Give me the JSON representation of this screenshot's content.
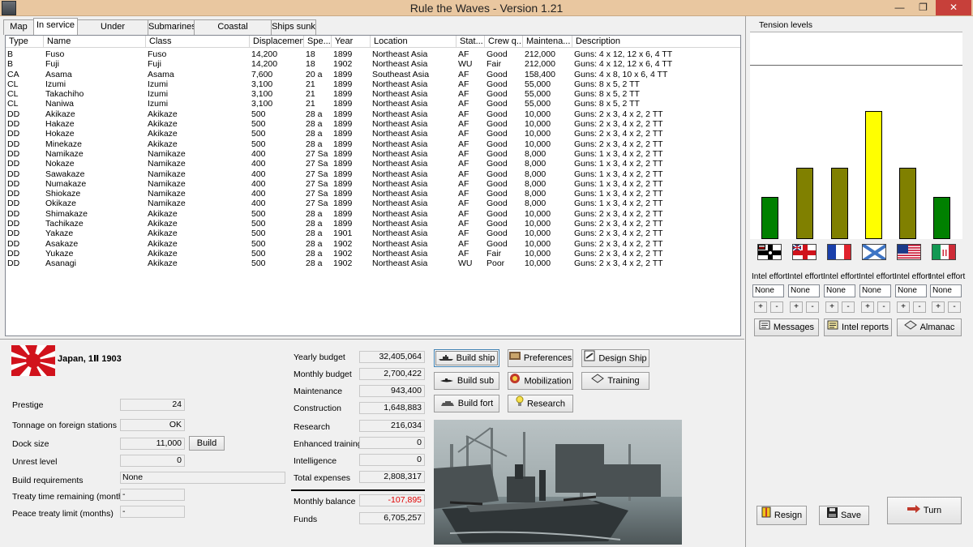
{
  "window": {
    "title": "Rule the Waves - Version 1.21",
    "min_glyph": "—",
    "max_glyph": "❐",
    "close_glyph": "✕"
  },
  "tabs": [
    {
      "label": "Map"
    },
    {
      "label": "In service"
    },
    {
      "label": "Under construction"
    },
    {
      "label": "Submarines"
    },
    {
      "label": "Coastal fortifications"
    },
    {
      "label": "Ships sunk"
    }
  ],
  "table": {
    "columns": [
      "Type",
      "Name",
      "Class",
      "Displacement",
      "Spe...",
      "Year",
      "Location",
      "Stat...",
      "Crew q...",
      "Maintena...",
      "Description"
    ],
    "rows": [
      [
        "B",
        "Fuso",
        "Fuso",
        "14,200",
        "18",
        "1899",
        "Northeast Asia",
        "AF",
        "Good",
        "212,000",
        "Guns: 4 x 12, 12 x 6, 4 TT"
      ],
      [
        "B",
        "Fuji",
        "Fuji",
        "14,200",
        "18",
        "1902",
        "Northeast Asia",
        "WU",
        "Fair",
        "212,000",
        "Guns: 4 x 12, 12 x 6, 4 TT"
      ],
      [
        "CA",
        "Asama",
        "Asama",
        "7,600",
        "20 a",
        "1899",
        "Southeast Asia",
        "AF",
        "Good",
        "158,400",
        "Guns: 4 x 8, 10 x 6, 4 TT"
      ],
      [
        "CL",
        "Izumi",
        "Izumi",
        "3,100",
        "21",
        "1899",
        "Northeast Asia",
        "AF",
        "Good",
        "55,000",
        "Guns: 8 x 5, 2 TT"
      ],
      [
        "CL",
        "Takachiho",
        "Izumi",
        "3,100",
        "21",
        "1899",
        "Northeast Asia",
        "AF",
        "Good",
        "55,000",
        "Guns: 8 x 5, 2 TT"
      ],
      [
        "CL",
        "Naniwa",
        "Izumi",
        "3,100",
        "21",
        "1899",
        "Northeast Asia",
        "AF",
        "Good",
        "55,000",
        "Guns: 8 x 5, 2 TT"
      ],
      [
        "DD",
        "Akikaze",
        "Akikaze",
        "500",
        "28 a",
        "1899",
        "Northeast Asia",
        "AF",
        "Good",
        "10,000",
        "Guns: 2 x 3, 4 x 2, 2 TT"
      ],
      [
        "DD",
        "Hakaze",
        "Akikaze",
        "500",
        "28 a",
        "1899",
        "Northeast Asia",
        "AF",
        "Good",
        "10,000",
        "Guns: 2 x 3, 4 x 2, 2 TT"
      ],
      [
        "DD",
        "Hokaze",
        "Akikaze",
        "500",
        "28 a",
        "1899",
        "Northeast Asia",
        "AF",
        "Good",
        "10,000",
        "Guns: 2 x 3, 4 x 2, 2 TT"
      ],
      [
        "DD",
        "Minekaze",
        "Akikaze",
        "500",
        "28 a",
        "1899",
        "Northeast Asia",
        "AF",
        "Good",
        "10,000",
        "Guns: 2 x 3, 4 x 2, 2 TT"
      ],
      [
        "DD",
        "Namikaze",
        "Namikaze",
        "400",
        "27 Sa",
        "1899",
        "Northeast Asia",
        "AF",
        "Good",
        "8,000",
        "Guns: 1 x 3, 4 x 2, 2 TT"
      ],
      [
        "DD",
        "Nokaze",
        "Namikaze",
        "400",
        "27 Sa",
        "1899",
        "Northeast Asia",
        "AF",
        "Good",
        "8,000",
        "Guns: 1 x 3, 4 x 2, 2 TT"
      ],
      [
        "DD",
        "Sawakaze",
        "Namikaze",
        "400",
        "27 Sa",
        "1899",
        "Northeast Asia",
        "AF",
        "Good",
        "8,000",
        "Guns: 1 x 3, 4 x 2, 2 TT"
      ],
      [
        "DD",
        "Numakaze",
        "Namikaze",
        "400",
        "27 Sa",
        "1899",
        "Northeast Asia",
        "AF",
        "Good",
        "8,000",
        "Guns: 1 x 3, 4 x 2, 2 TT"
      ],
      [
        "DD",
        "Shiokaze",
        "Namikaze",
        "400",
        "27 Sa",
        "1899",
        "Northeast Asia",
        "AF",
        "Good",
        "8,000",
        "Guns: 1 x 3, 4 x 2, 2 TT"
      ],
      [
        "DD",
        "Okikaze",
        "Namikaze",
        "400",
        "27 Sa",
        "1899",
        "Northeast Asia",
        "AF",
        "Good",
        "8,000",
        "Guns: 1 x 3, 4 x 2, 2 TT"
      ],
      [
        "DD",
        "Shimakaze",
        "Akikaze",
        "500",
        "28 a",
        "1899",
        "Northeast Asia",
        "AF",
        "Good",
        "10,000",
        "Guns: 2 x 3, 4 x 2, 2 TT"
      ],
      [
        "DD",
        "Tachikaze",
        "Akikaze",
        "500",
        "28 a",
        "1899",
        "Northeast Asia",
        "AF",
        "Good",
        "10,000",
        "Guns: 2 x 3, 4 x 2, 2 TT"
      ],
      [
        "DD",
        "Yakaze",
        "Akikaze",
        "500",
        "28 a",
        "1901",
        "Northeast Asia",
        "AF",
        "Good",
        "10,000",
        "Guns: 2 x 3, 4 x 2, 2 TT"
      ],
      [
        "DD",
        "Asakaze",
        "Akikaze",
        "500",
        "28 a",
        "1902",
        "Northeast Asia",
        "AF",
        "Good",
        "10,000",
        "Guns: 2 x 3, 4 x 2, 2 TT"
      ],
      [
        "DD",
        "Yukaze",
        "Akikaze",
        "500",
        "28 a",
        "1902",
        "Northeast Asia",
        "AF",
        "Fair",
        "10,000",
        "Guns: 2 x 3, 4 x 2, 2 TT"
      ],
      [
        "DD",
        "Asanagi",
        "Akikaze",
        "500",
        "28 a",
        "1902",
        "Northeast Asia",
        "WU",
        "Poor",
        "10,000",
        "Guns: 2 x 3, 4 x 2, 2 TT"
      ]
    ]
  },
  "nation": {
    "title": "Japan, 1Ⅱ 1903"
  },
  "status": {
    "prestige_label": "Prestige",
    "prestige": "24",
    "tonnage_label": "Tonnage on foreign stations",
    "tonnage": "OK",
    "dock_label": "Dock size",
    "dock": "11,000",
    "dock_build": "Build",
    "unrest_label": "Unrest level",
    "unrest": "0",
    "buildreq_label": "Build requirements",
    "buildreq": "None",
    "treaty_label": "Treaty time remaining (months)",
    "treaty": "-",
    "peace_label": "Peace treaty limit (months)",
    "peace": "-"
  },
  "budget": {
    "yearly_label": "Yearly budget",
    "yearly": "32,405,064",
    "monthly_label": "Monthly budget",
    "monthly": "2,700,422",
    "maint_label": "Maintenance",
    "maint": "943,400",
    "constr_label": "Construction",
    "constr": "1,648,883",
    "research_label": "Research",
    "research": "216,034",
    "training_label": "Enhanced training",
    "training": "0",
    "intel_label": "Intelligence",
    "intel": "0",
    "total_label": "Total expenses",
    "total": "2,808,317",
    "balance_label": "Monthly balance",
    "balance": "-107,895",
    "funds_label": "Funds",
    "funds": "6,705,257"
  },
  "actions": {
    "build_ship": "Build ship",
    "build_sub": "Build sub",
    "build_fort": "Build fort",
    "preferences": "Preferences",
    "mobilization": "Mobilization",
    "research": "Research",
    "design_ship": "Design Ship",
    "training": "Training"
  },
  "tension": {
    "title": "Tension levels",
    "scale_max": 1.0,
    "levels": [
      0.33,
      0.56,
      0.56,
      1.0,
      0.56,
      0.33
    ],
    "colors": [
      "#008000",
      "#808000",
      "#808000",
      "#ffff00",
      "#808000",
      "#008000"
    ],
    "flags": [
      "german-flag-icon",
      "british-flag-icon",
      "french-flag-icon",
      "russian-flag-icon",
      "us-flag-icon",
      "italian-flag-icon"
    ]
  },
  "intel": {
    "label": "Intel effort",
    "values": [
      "None",
      "None",
      "None",
      "None",
      "None",
      "None"
    ],
    "plus": "+",
    "minus": "-"
  },
  "rightbuttons": {
    "messages": "Messages",
    "intel_reports": "Intel reports",
    "almanac": "Almanac",
    "resign": "Resign",
    "save": "Save",
    "turn": "Turn"
  }
}
